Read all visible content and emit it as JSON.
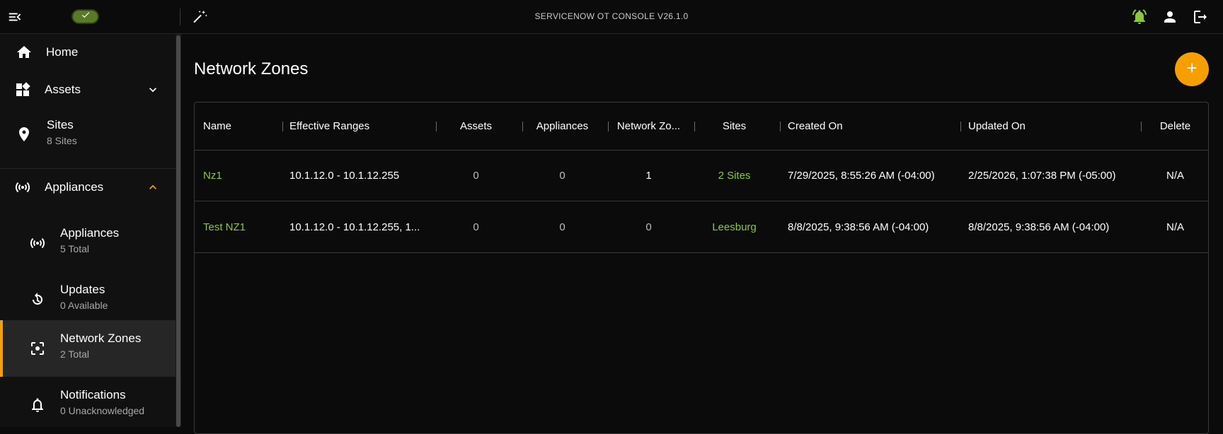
{
  "topbar": {
    "title": "SERVICENOW OT CONSOLE V26.1.0",
    "icons": [
      "menu-collapse-icon",
      "check-icon",
      "magic-wand-icon",
      "bell-ring-icon",
      "user-icon",
      "logout-icon"
    ]
  },
  "sidebar": {
    "home": {
      "label": "Home"
    },
    "assets": {
      "label": "Assets"
    },
    "sites": {
      "label": "Sites",
      "sub": "8 Sites"
    },
    "appliances_group": {
      "label": "Appliances"
    },
    "appliances": {
      "label": "Appliances",
      "sub": "5 Total"
    },
    "updates": {
      "label": "Updates",
      "sub": "0 Available"
    },
    "network_zones": {
      "label": "Network Zones",
      "sub": "2 Total"
    },
    "notifications": {
      "label": "Notifications",
      "sub": "0 Unacknowledged"
    }
  },
  "main": {
    "title": "Network Zones",
    "add_icon": "plus-icon"
  },
  "table": {
    "headers": {
      "name": "Name",
      "ranges": "Effective Ranges",
      "assets": "Assets",
      "appliances": "Appliances",
      "network_zones": "Network Zo...",
      "sites": "Sites",
      "created": "Created On",
      "updated": "Updated On",
      "delete": "Delete"
    },
    "rows": [
      {
        "name": "Nz1",
        "ranges": "10.1.12.0 - 10.1.12.255",
        "assets": "0",
        "appliances": "0",
        "network_zones": "1",
        "sites": "2 Sites",
        "created": "7/29/2025, 8:55:26 AM (-04:00)",
        "updated": "2/25/2026, 1:07:38 PM (-05:00)",
        "delete": "N/A"
      },
      {
        "name": "Test NZ1",
        "ranges": "10.1.12.0 - 10.1.12.255, 1...",
        "assets": "0",
        "appliances": "0",
        "network_zones": "0",
        "sites": "Leesburg",
        "created": "8/8/2025, 9:38:56 AM (-04:00)",
        "updated": "8/8/2025, 9:38:56 AM (-04:00)",
        "delete": "N/A"
      }
    ]
  },
  "colors": {
    "accent_orange": "#f5a000",
    "link_green": "#8cc63f",
    "status_green": "#5a7a28",
    "background": "#0b0b0b",
    "sidebar_bg": "#111111"
  }
}
